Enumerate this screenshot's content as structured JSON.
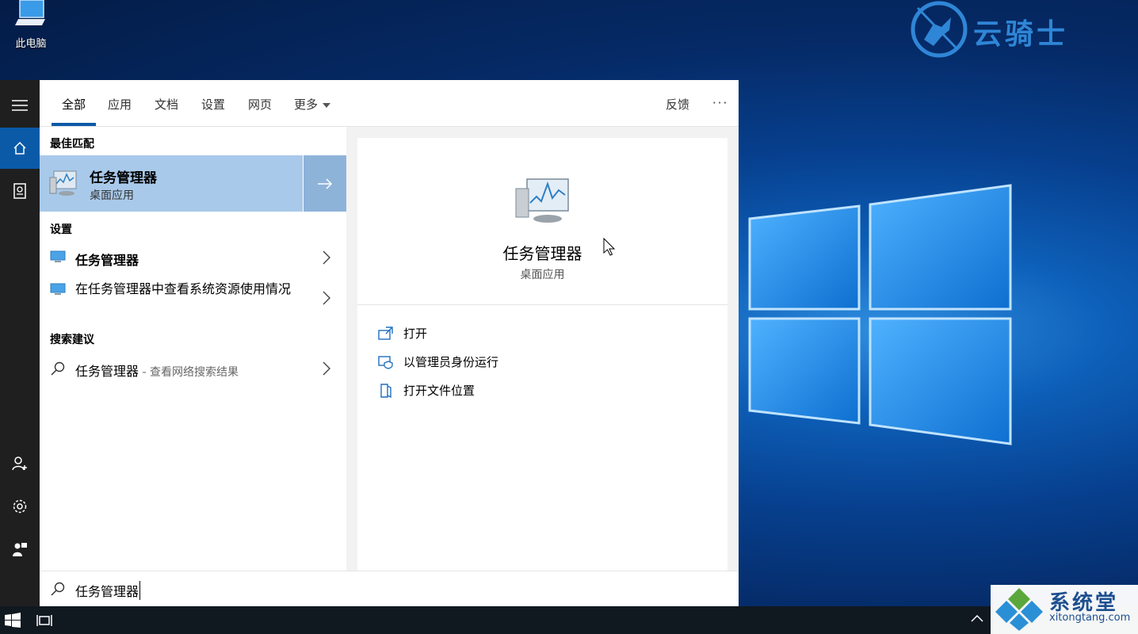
{
  "desktop": {
    "icon_label": "此电脑",
    "brand_logo_text": "云骑士",
    "watermark_title": "系统堂",
    "watermark_url": "xitongtang.com"
  },
  "tabs": [
    "全部",
    "应用",
    "文档",
    "设置",
    "网页",
    "更多"
  ],
  "header_right": {
    "feedback": "反馈",
    "more": "···"
  },
  "left": {
    "best_match_heading": "最佳匹配",
    "best_match": {
      "title": "任务管理器",
      "subtitle": "桌面应用"
    },
    "settings_heading": "设置",
    "settings_items": [
      "任务管理器",
      "在任务管理器中查看系统资源使用情况"
    ],
    "suggest_heading": "搜索建议",
    "suggest_item": {
      "label": "任务管理器",
      "hint": " - 查看网络搜索结果"
    }
  },
  "preview": {
    "title": "任务管理器",
    "subtitle": "桌面应用",
    "actions": [
      "打开",
      "以管理员身份运行",
      "打开文件位置"
    ]
  },
  "search": {
    "query": "任务管理器"
  },
  "colors": {
    "accent": "#0a5aa8",
    "selected": "#a8c9ea",
    "rail": "#1f1f1f"
  }
}
